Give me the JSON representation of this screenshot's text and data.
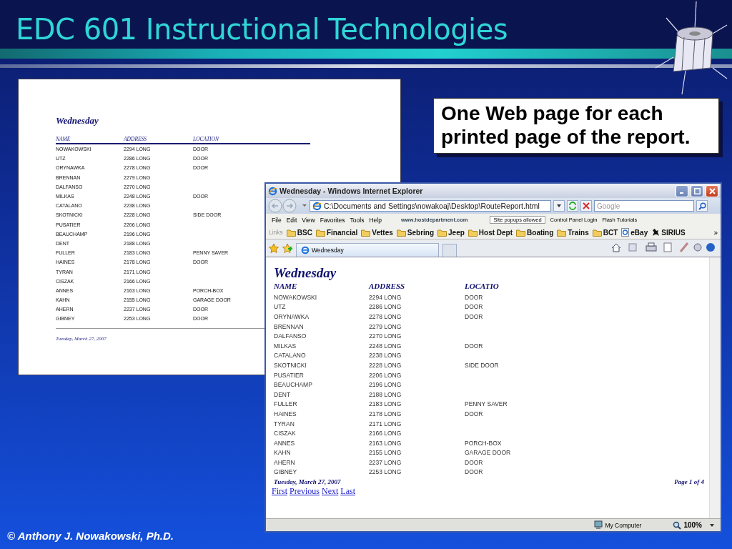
{
  "slide": {
    "title": "EDC 601 Instructional Technologies",
    "callout": "One Web page for each printed page of the report.",
    "footer": "© Anthony J. Nowakowski, Ph.D."
  },
  "printed_report": {
    "title": "Wednesday",
    "columns": [
      "NAME",
      "ADDRESS",
      "LOCATION"
    ],
    "rows": [
      {
        "name": "NOWAKOWSKI",
        "address": "2294 LONG",
        "location": "DOOR"
      },
      {
        "name": "UTZ",
        "address": "2286 LONG",
        "location": "DOOR"
      },
      {
        "name": "ORYNAWKA",
        "address": "2278 LONG",
        "location": "DOOR"
      },
      {
        "name": "BRENNAN",
        "address": "2279 LONG"
      },
      {
        "name": "DALFANSO",
        "address": "2270 LONG"
      },
      {
        "name": "MILKAS",
        "address": "2248 LONG",
        "location": "DOOR"
      },
      {
        "name": "CATALANO",
        "address": "2238 LONG"
      },
      {
        "name": "SKOTNICKI",
        "address": "2228 LONG",
        "location": "SIDE DOOR"
      },
      {
        "name": "PUSATIER",
        "address": "2206 LONG"
      },
      {
        "name": "BEAUCHAMP",
        "address": "2196 LONG"
      },
      {
        "name": "DENT",
        "address": "2188 LONG"
      },
      {
        "name": "FULLER",
        "address": "2183 LONG",
        "location": "PENNY SAVER"
      },
      {
        "name": "HAINES",
        "address": "2178 LONG",
        "location": "DOOR"
      },
      {
        "name": "TYRAN",
        "address": "2171 LONG"
      },
      {
        "name": "CISZAK",
        "address": "2166 LONG"
      },
      {
        "name": "ANNES",
        "address": "2163 LONG",
        "location": "PORCH-BOX"
      },
      {
        "name": "KAHN",
        "address": "2155 LONG",
        "location": "GARAGE DOOR"
      },
      {
        "name": "AHERN",
        "address": "2237 LONG",
        "location": "DOOR"
      },
      {
        "name": "GIBNEY",
        "address": "2253 LONG",
        "location": "DOOR"
      }
    ],
    "date": "Tuesday, March 27, 2007"
  },
  "browser": {
    "title": "Wednesday - Windows Internet Explorer",
    "address": "C:\\Documents and Settings\\nowakoaj\\Desktop\\RouteReport.html",
    "search_placeholder": "Google",
    "menu": [
      "File",
      "Edit",
      "View",
      "Favorites",
      "Tools",
      "Help"
    ],
    "site_link": "www.hostdepartment.com",
    "popups": "Site popups allowed",
    "toolbar_links": [
      "Control Panel Login",
      "Flash Tutorials"
    ],
    "links_label": "Links",
    "favorites": [
      {
        "label": "BSC",
        "kind": "folder"
      },
      {
        "label": "Financial",
        "kind": "folder"
      },
      {
        "label": "Vettes",
        "kind": "folder"
      },
      {
        "label": "Sebring",
        "kind": "folder"
      },
      {
        "label": "Jeep",
        "kind": "folder"
      },
      {
        "label": "Host Dept",
        "kind": "folder"
      },
      {
        "label": "Boating",
        "kind": "folder"
      },
      {
        "label": "Trains",
        "kind": "folder"
      },
      {
        "label": "BCT",
        "kind": "folder"
      },
      {
        "label": "eBay",
        "kind": "page"
      },
      {
        "label": "SIRIUS",
        "kind": "mascot"
      }
    ],
    "chevron": "»",
    "tabs": [
      {
        "label": "Wednesday",
        "selected": true
      }
    ],
    "page": {
      "title": "Wednesday",
      "columns": [
        "NAME",
        "ADDRESS",
        "LOCATIO"
      ],
      "rows": [
        {
          "name": "NOWAKOWSKI",
          "address": "2294 LONG",
          "location": "DOOR"
        },
        {
          "name": "UTZ",
          "address": "2286 LONG",
          "location": "DOOR"
        },
        {
          "name": "ORYNAWKA",
          "address": "2278 LONG",
          "location": "DOOR"
        },
        {
          "name": "BRENNAN",
          "address": "2279 LONG"
        },
        {
          "name": "DALFANSO",
          "address": "2270 LONG"
        },
        {
          "name": "MILKAS",
          "address": "2248 LONG",
          "location": "DOOR"
        },
        {
          "name": "CATALANO",
          "address": "2238 LONG"
        },
        {
          "name": "SKOTNICKI",
          "address": "2228 LONG",
          "location": "SIDE DOOR"
        },
        {
          "name": "PUSATIER",
          "address": "2206 LONG"
        },
        {
          "name": "BEAUCHAMP",
          "address": "2196 LONG"
        },
        {
          "name": "DENT",
          "address": "2188 LONG"
        },
        {
          "name": "FULLER",
          "address": "2183 LONG",
          "location": "PENNY SAVER"
        },
        {
          "name": "HAINES",
          "address": "2178 LONG",
          "location": "DOOR"
        },
        {
          "name": "TYRAN",
          "address": "2171 LONG"
        },
        {
          "name": "CISZAK",
          "address": "2166 LONG"
        },
        {
          "name": "ANNES",
          "address": "2163 LONG",
          "location": "PORCH-BOX"
        },
        {
          "name": "KAHN",
          "address": "2155 LONG",
          "location": "GARAGE DOOR"
        },
        {
          "name": "AHERN",
          "address": "2237 LONG",
          "location": "DOOR"
        },
        {
          "name": "GIBNEY",
          "address": "2253 LONG",
          "location": "DOOR"
        }
      ],
      "date": "Tuesday, March 27, 2007",
      "page_label": "Page 1 of 4",
      "nav": [
        "First",
        "Previous",
        "Next",
        "Last"
      ]
    },
    "status": {
      "zone": "My Computer",
      "zoom": "100%"
    }
  }
}
